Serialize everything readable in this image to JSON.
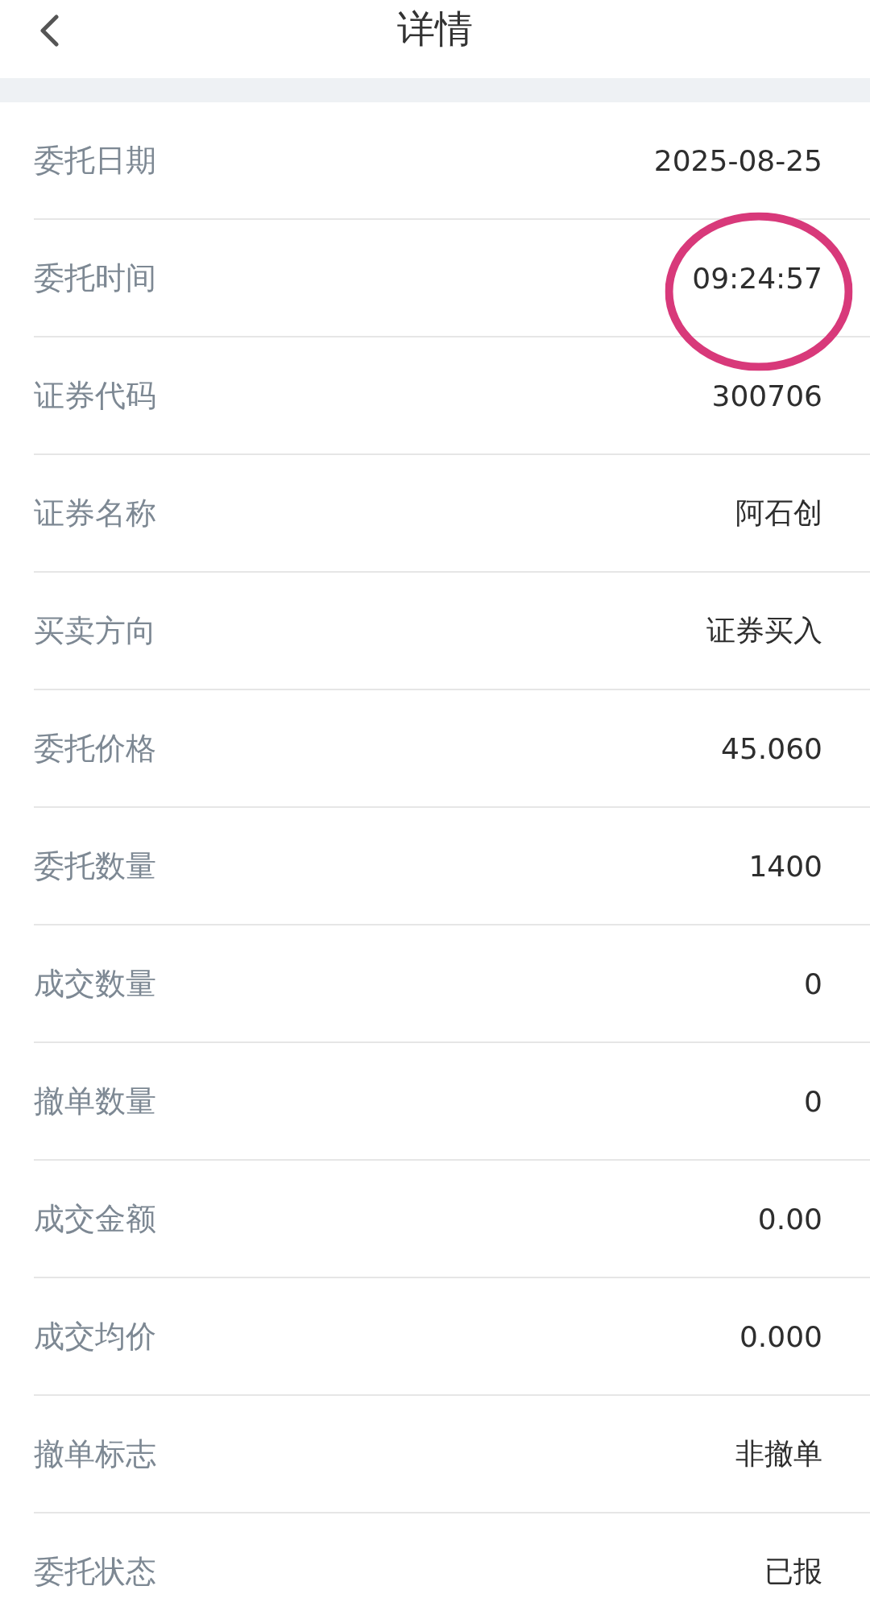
{
  "header": {
    "title": "详情"
  },
  "rows": [
    {
      "label": "委托日期",
      "value": "2025-08-25",
      "circled": false
    },
    {
      "label": "委托时间",
      "value": "09:24:57",
      "circled": true
    },
    {
      "label": "证券代码",
      "value": "300706",
      "circled": false
    },
    {
      "label": "证券名称",
      "value": "阿石创",
      "circled": false
    },
    {
      "label": "买卖方向",
      "value": "证券买入",
      "circled": false
    },
    {
      "label": "委托价格",
      "value": "45.060",
      "circled": false
    },
    {
      "label": "委托数量",
      "value": "1400",
      "circled": false
    },
    {
      "label": "成交数量",
      "value": "0",
      "circled": false
    },
    {
      "label": "撤单数量",
      "value": "0",
      "circled": false
    },
    {
      "label": "成交金额",
      "value": "0.00",
      "circled": false
    },
    {
      "label": "成交均价",
      "value": "0.000",
      "circled": false
    },
    {
      "label": "撤单标志",
      "value": "非撤单",
      "circled": false
    },
    {
      "label": "委托状态",
      "value": "已报",
      "circled": false
    }
  ]
}
